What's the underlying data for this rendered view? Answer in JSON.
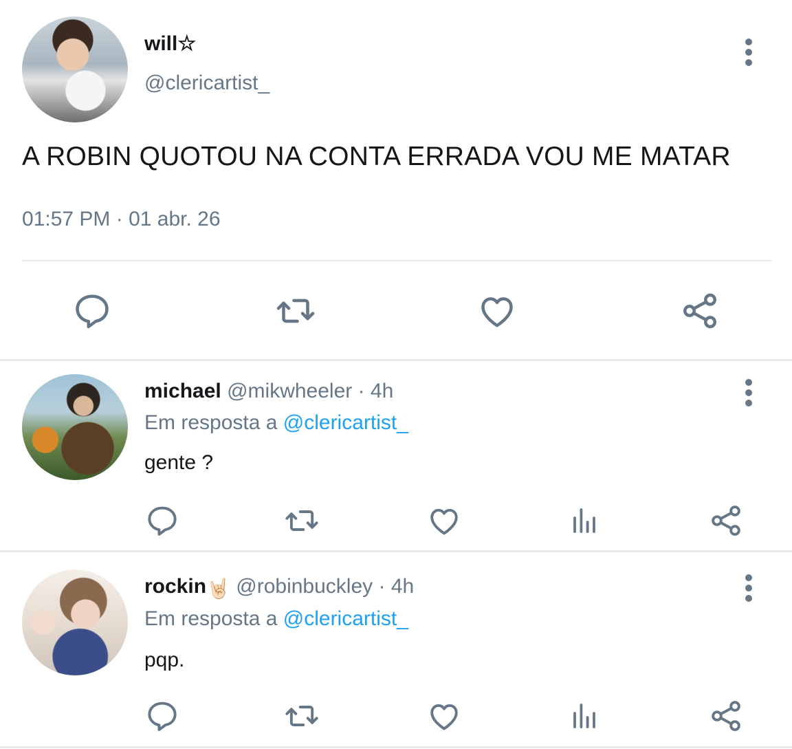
{
  "main_tweet": {
    "name": "will☆",
    "handle": "@clericartist_",
    "text": "A ROBIN QUOTOU NA CONTA ERRADA VOU ME MATAR",
    "time": "01:57 PM",
    "meta_separator": " · ",
    "date": "01 abr. 26",
    "icons": [
      "reply-icon",
      "retweet-icon",
      "like-icon",
      "share-icon"
    ]
  },
  "replies": [
    {
      "name": "michael",
      "handle": "@mikwheeler",
      "separator": " · ",
      "time": "4h",
      "reply_prefix": "Em resposta a ",
      "reply_to": "@clericartist_",
      "text": "gente ?",
      "icons": [
        "reply-icon",
        "retweet-icon",
        "like-icon",
        "analytics-icon",
        "share-icon"
      ]
    },
    {
      "name": "rockin",
      "name_emoji": "🤘🏻",
      "handle": "@robinbuckley",
      "separator": " · ",
      "time": "4h",
      "reply_prefix": "Em resposta a ",
      "reply_to": "@clericartist_",
      "text": "pqp.",
      "icons": [
        "reply-icon",
        "retweet-icon",
        "like-icon",
        "analytics-icon",
        "share-icon"
      ]
    }
  ],
  "colors": {
    "text": "#14171a",
    "secondary": "#657786",
    "link": "#1da1f2",
    "divider": "#e6ecf0"
  }
}
